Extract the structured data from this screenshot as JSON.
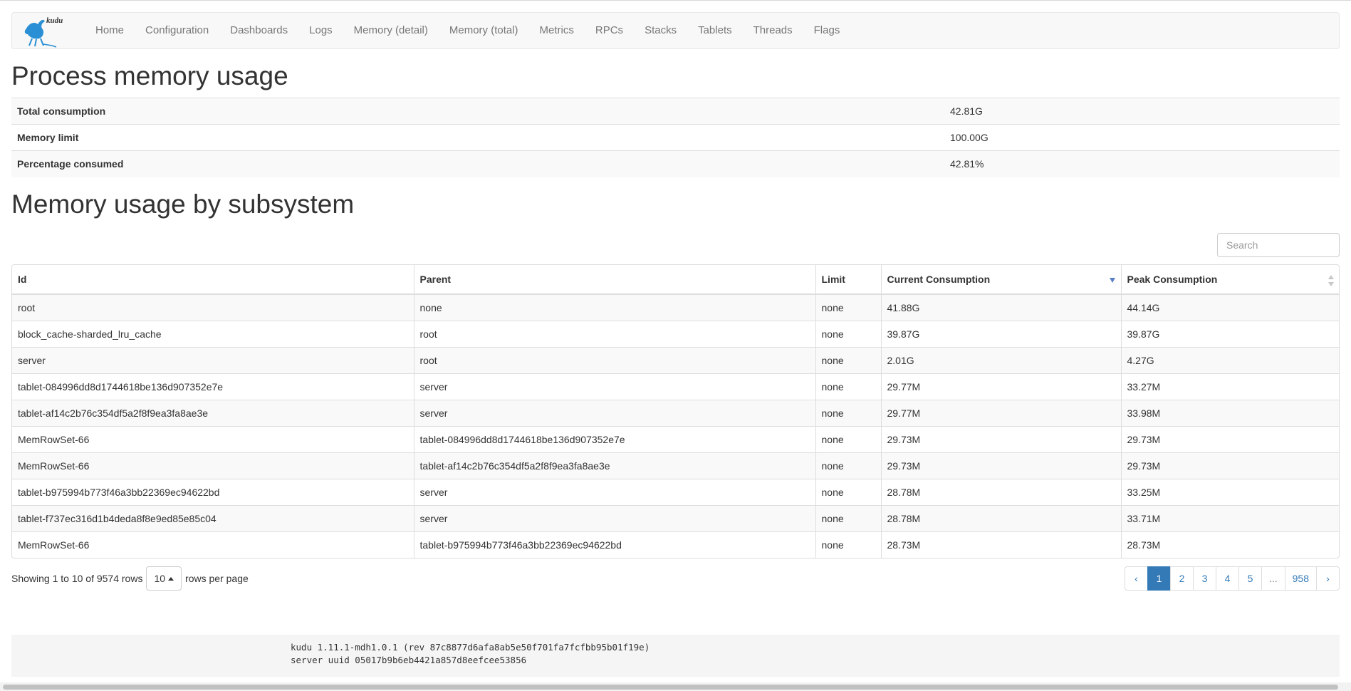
{
  "nav": {
    "logo_text": "kudu",
    "items": [
      "Home",
      "Configuration",
      "Dashboards",
      "Logs",
      "Memory (detail)",
      "Memory (total)",
      "Metrics",
      "RPCs",
      "Stacks",
      "Tablets",
      "Threads",
      "Flags"
    ]
  },
  "process": {
    "title": "Process memory usage",
    "rows": [
      {
        "label": "Total consumption",
        "value": "42.81G"
      },
      {
        "label": "Memory limit",
        "value": "100.00G"
      },
      {
        "label": "Percentage consumed",
        "value": "42.81%"
      }
    ]
  },
  "subsystem": {
    "title": "Memory usage by subsystem",
    "search_placeholder": "Search",
    "columns": [
      "Id",
      "Parent",
      "Limit",
      "Current Consumption",
      "Peak Consumption"
    ],
    "rows": [
      [
        "root",
        "none",
        "none",
        "41.88G",
        "44.14G"
      ],
      [
        "block_cache-sharded_lru_cache",
        "root",
        "none",
        "39.87G",
        "39.87G"
      ],
      [
        "server",
        "root",
        "none",
        "2.01G",
        "4.27G"
      ],
      [
        "tablet-084996dd8d1744618be136d907352e7e",
        "server",
        "none",
        "29.77M",
        "33.27M"
      ],
      [
        "tablet-af14c2b76c354df5a2f8f9ea3fa8ae3e",
        "server",
        "none",
        "29.77M",
        "33.98M"
      ],
      [
        "MemRowSet-66",
        "tablet-084996dd8d1744618be136d907352e7e",
        "none",
        "29.73M",
        "29.73M"
      ],
      [
        "MemRowSet-66",
        "tablet-af14c2b76c354df5a2f8f9ea3fa8ae3e",
        "none",
        "29.73M",
        "29.73M"
      ],
      [
        "tablet-b975994b773f46a3bb22369ec94622bd",
        "server",
        "none",
        "28.78M",
        "33.25M"
      ],
      [
        "tablet-f737ec316d1b4deda8f8e9ed85e85c04",
        "server",
        "none",
        "28.78M",
        "33.71M"
      ],
      [
        "MemRowSet-66",
        "tablet-b975994b773f46a3bb22369ec94622bd",
        "none",
        "28.73M",
        "28.73M"
      ]
    ],
    "showing_text": "Showing 1 to 10 of 9574 rows",
    "page_size": "10",
    "rows_per_page_text": "rows per page",
    "pagination": [
      "‹",
      "1",
      "2",
      "3",
      "4",
      "5",
      "...",
      "958",
      "›"
    ],
    "active_page": "1"
  },
  "footer": {
    "version_line": "kudu 1.11.1-mdh1.0.1 (rev 87c8877d6afa8ab5e50f701fa7fcfbb95b01f19e)",
    "uuid_line": "server uuid 05017b9b6eb4421a857d8eefcee53856"
  },
  "colors": {
    "accent": "#337ab7",
    "sort_indicator": "#5b7fc7",
    "logo_blue": "#2a8fd4"
  }
}
